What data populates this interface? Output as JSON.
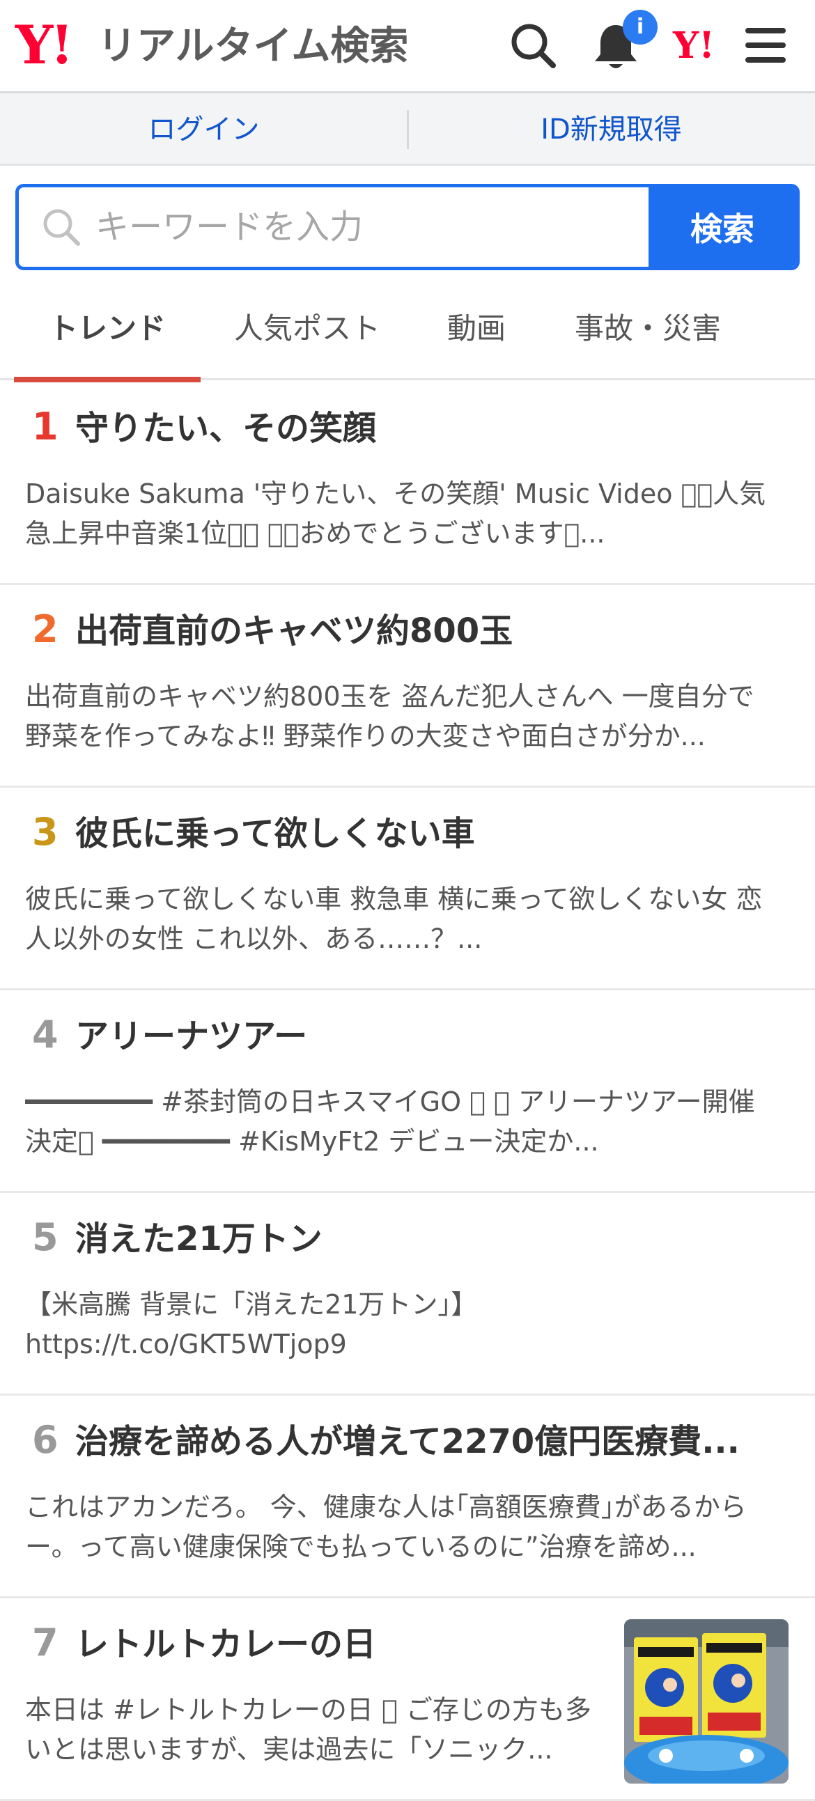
{
  "header": {
    "logo": "Y!",
    "title": "リアルタイム検索",
    "notification_badge": "i",
    "yahoo_small_logo": "Y!",
    "icons": [
      "search-icon",
      "bell-icon",
      "yahoo-logo",
      "menu-icon"
    ]
  },
  "auth": {
    "login": "ログイン",
    "register": "ID新規取得"
  },
  "search": {
    "placeholder": "キーワードを入力",
    "button": "検索"
  },
  "tabs": [
    {
      "label": "トレンド",
      "active": true
    },
    {
      "label": "人気ポスト"
    },
    {
      "label": "動画"
    },
    {
      "label": "事故・災害"
    }
  ],
  "trends": [
    {
      "rank": "1",
      "title": "守りたい、その笑顔",
      "desc": "Daisuke Sakuma '守りたい、その笑顔' Music Video 􀀀􀀀人気急上昇中音楽1位􀀀􀀀 􀀀􀀀おめでとうございます􀀀..."
    },
    {
      "rank": "2",
      "title": "出荷直前のキャベツ約800玉",
      "desc": "出荷直前のキャベツ約800玉を 盗んだ犯人さんへ 一度自分で野菜を作ってみなよ‼ 野菜作りの大変さや面白さが分か..."
    },
    {
      "rank": "3",
      "title": "彼氏に乗って欲しくない車",
      "desc": "彼氏に乗って欲しくない車 救急車 横に乗って欲しくない女 恋人以外の女性 これ以外、ある……？..."
    },
    {
      "rank": "4",
      "title": "アリーナツアー",
      "desc": "━━━━━━━━ #茶封筒の日キスマイGO 􀀀 􀀀 アリーナツアー開催決定􀀀 ━━━━━━━━ #KisMyFt2 デビュー決定か..."
    },
    {
      "rank": "5",
      "title": "消えた21万トン",
      "desc": "【米高騰 背景に「消えた21万トン」】 https://t.co/GKT5WTjop9"
    },
    {
      "rank": "6",
      "title": "治療を諦める人が増えて2270億円医療費...",
      "desc": "これはアカンだろ。 今、健康な人は｢高額医療費｣があるからー。って高い健康保険でも払っているのに”治療を諦め..."
    },
    {
      "rank": "7",
      "title": "レトルトカレーの日",
      "desc": "本日は #レトルトカレーの日 􀀀 ご存じの方も多いとは思いますが、実は過去に「ソニック..."
    }
  ],
  "colors": {
    "brand_red": "#ff0033",
    "accent_blue": "#1e6ff0",
    "tab_underline": "#d94b3f",
    "rank1": "#e8372c",
    "rank2": "#f06a2d",
    "rank3": "#c9961a"
  }
}
